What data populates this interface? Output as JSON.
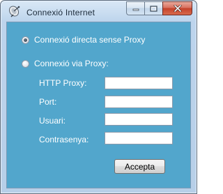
{
  "window": {
    "title": "Connexió Internet",
    "caption_buttons": [
      "minimize-icon",
      "maximize-icon",
      "close-icon"
    ]
  },
  "form": {
    "option_direct": {
      "label": "Connexió directa sense Proxy",
      "selected": true
    },
    "option_proxy": {
      "label": "Connexió via Proxy:",
      "selected": false
    },
    "fields": [
      {
        "label": "HTTP Proxy:",
        "value": ""
      },
      {
        "label": "Port:",
        "value": ""
      },
      {
        "label": "Usuari:",
        "value": ""
      },
      {
        "label": "Contrasenya:",
        "value": ""
      }
    ],
    "accept_label": "Accepta"
  },
  "colors": {
    "client_background": "#52a6cc",
    "label_text": "#ffffff",
    "close_button": "#c4412a"
  }
}
